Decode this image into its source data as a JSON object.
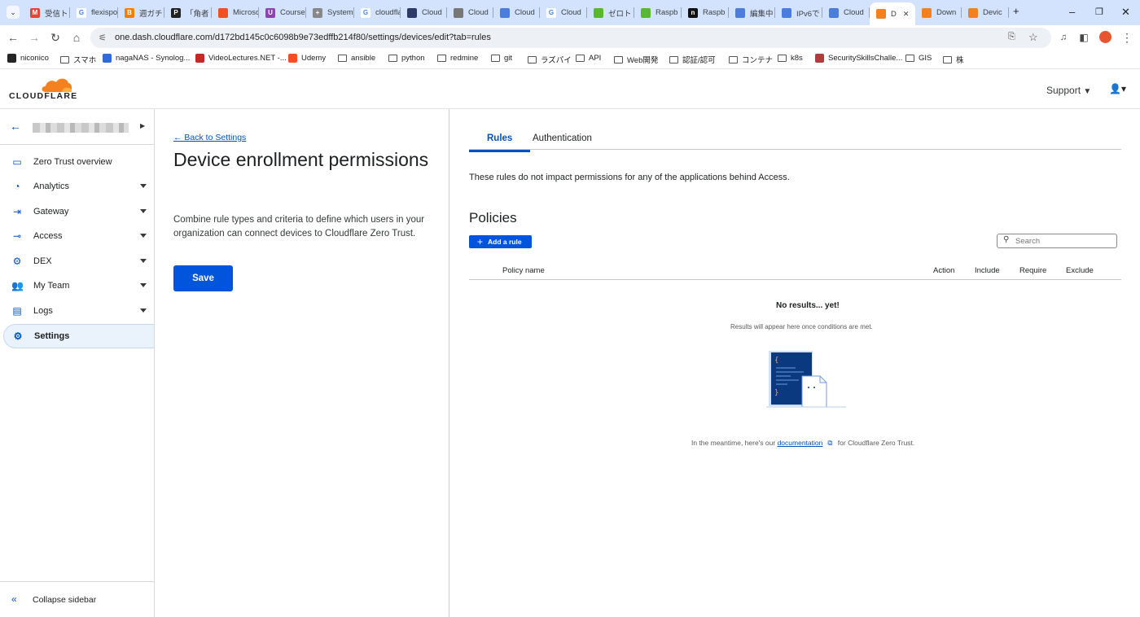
{
  "browser": {
    "tabs": [
      {
        "label": "受信トレイ",
        "fav": "#ea4335",
        "glyph": "M"
      },
      {
        "label": "flexispot",
        "fav": "#ffffff",
        "glyph": "G"
      },
      {
        "label": "週ガチ",
        "fav": "#f57d00",
        "glyph": "B"
      },
      {
        "label": "「角者",
        "fav": "#222222",
        "glyph": "P"
      },
      {
        "label": "Microsoft",
        "fav": "#f25022",
        "glyph": ""
      },
      {
        "label": "Course",
        "fav": "#8e44ad",
        "glyph": "U"
      },
      {
        "label": "System",
        "fav": "#888888",
        "glyph": "+"
      },
      {
        "label": "cloudflare",
        "fav": "#ffffff",
        "glyph": "G"
      },
      {
        "label": "Cloud",
        "fav": "#2b3a67",
        "glyph": ""
      },
      {
        "label": "Cloud",
        "fav": "#777777",
        "glyph": ""
      },
      {
        "label": "Cloud",
        "fav": "#4a7ddc",
        "glyph": ""
      },
      {
        "label": "Cloud",
        "fav": "#ffffff",
        "glyph": "G"
      },
      {
        "label": "ゼロト",
        "fav": "#58b830",
        "glyph": ""
      },
      {
        "label": "Raspb",
        "fav": "#58b830",
        "glyph": ""
      },
      {
        "label": "Raspb",
        "fav": "#111111",
        "glyph": "n"
      },
      {
        "label": "編集中",
        "fav": "#4a7ddc",
        "glyph": ""
      },
      {
        "label": "IPv6で",
        "fav": "#4a7ddc",
        "glyph": ""
      },
      {
        "label": "Cloud",
        "fav": "#4a7ddc",
        "glyph": ""
      },
      {
        "label": "D",
        "fav": "#f48120",
        "glyph": ""
      },
      {
        "label": "Down",
        "fav": "#f48120",
        "glyph": ""
      },
      {
        "label": "Devic",
        "fav": "#f48120",
        "glyph": ""
      }
    ],
    "url": "one.dash.cloudflare.com/d172bd145c0c6098b9e73edffb214f80/settings/devices/edit?tab=rules",
    "bookmarks": [
      {
        "label": "niconico",
        "kind": "fav",
        "color": "#252525"
      },
      {
        "label": "スマホ",
        "kind": "folder"
      },
      {
        "label": "nagaNAS - Synolog...",
        "kind": "fav",
        "color": "#2e6bd6"
      },
      {
        "label": "VideoLectures.NET -...",
        "kind": "fav",
        "color": "#c62828"
      },
      {
        "label": "Udemy",
        "kind": "fav",
        "color": "#f25022"
      },
      {
        "label": "ansible",
        "kind": "folder"
      },
      {
        "label": "python",
        "kind": "folder"
      },
      {
        "label": "redmine",
        "kind": "folder"
      },
      {
        "label": "git",
        "kind": "folder"
      },
      {
        "label": "ラズパイ",
        "kind": "folder"
      },
      {
        "label": "API",
        "kind": "folder"
      },
      {
        "label": "Web開発",
        "kind": "folder"
      },
      {
        "label": "認証/認可",
        "kind": "folder"
      },
      {
        "label": "コンテナ",
        "kind": "folder"
      },
      {
        "label": "k8s",
        "kind": "folder"
      },
      {
        "label": "SecuritySkillsChalle...",
        "kind": "fav",
        "color": "#b23b3b"
      },
      {
        "label": "GIS",
        "kind": "folder"
      },
      {
        "label": "株",
        "kind": "folder"
      }
    ]
  },
  "header": {
    "logo_text": "CLOUDFLARE",
    "support_label": "Support"
  },
  "sidebar": {
    "items": [
      {
        "label": "Zero Trust overview",
        "icon": "overview-icon",
        "glyph": "▭",
        "caret": false,
        "active": false
      },
      {
        "label": "Analytics",
        "icon": "analytics-icon",
        "glyph": "◔",
        "caret": true,
        "active": false
      },
      {
        "label": "Gateway",
        "icon": "gateway-icon",
        "glyph": "⇥",
        "caret": true,
        "active": false
      },
      {
        "label": "Access",
        "icon": "access-icon",
        "glyph": "⊸",
        "caret": true,
        "active": false
      },
      {
        "label": "DEX",
        "icon": "dex-icon",
        "glyph": "⚙",
        "caret": true,
        "active": false
      },
      {
        "label": "My Team",
        "icon": "team-icon",
        "glyph": "👥",
        "caret": true,
        "active": false
      },
      {
        "label": "Logs",
        "icon": "logs-icon",
        "glyph": "▤",
        "caret": true,
        "active": false
      },
      {
        "label": "Settings",
        "icon": "settings-icon",
        "glyph": "⚙",
        "caret": false,
        "active": true
      }
    ],
    "collapse_label": "Collapse sidebar"
  },
  "middle": {
    "back_link": "← Back to Settings",
    "title": "Device enrollment permissions",
    "description": "Combine rule types and criteria to define which users in your organization can connect devices to Cloudflare Zero Trust.",
    "save_label": "Save"
  },
  "right": {
    "tabs": [
      "Rules",
      "Authentication"
    ],
    "info": "These rules do not impact permissions for any of the applications behind Access.",
    "policies_heading": "Policies",
    "add_rule_label": "Add a rule",
    "search_placeholder": "Search",
    "columns": [
      "Policy name",
      "Action",
      "Include",
      "Require",
      "Exclude"
    ],
    "empty_title": "No results... yet!",
    "empty_subtitle": "Results will appear here once conditions are met.",
    "footer_before": "In the meantime, here's our ",
    "footer_link": "documentation",
    "footer_after": " for Cloudflare Zero Trust."
  },
  "colors": {
    "accent": "#0051c3",
    "button": "#0055dc",
    "cloud_orange": "#f48120"
  }
}
